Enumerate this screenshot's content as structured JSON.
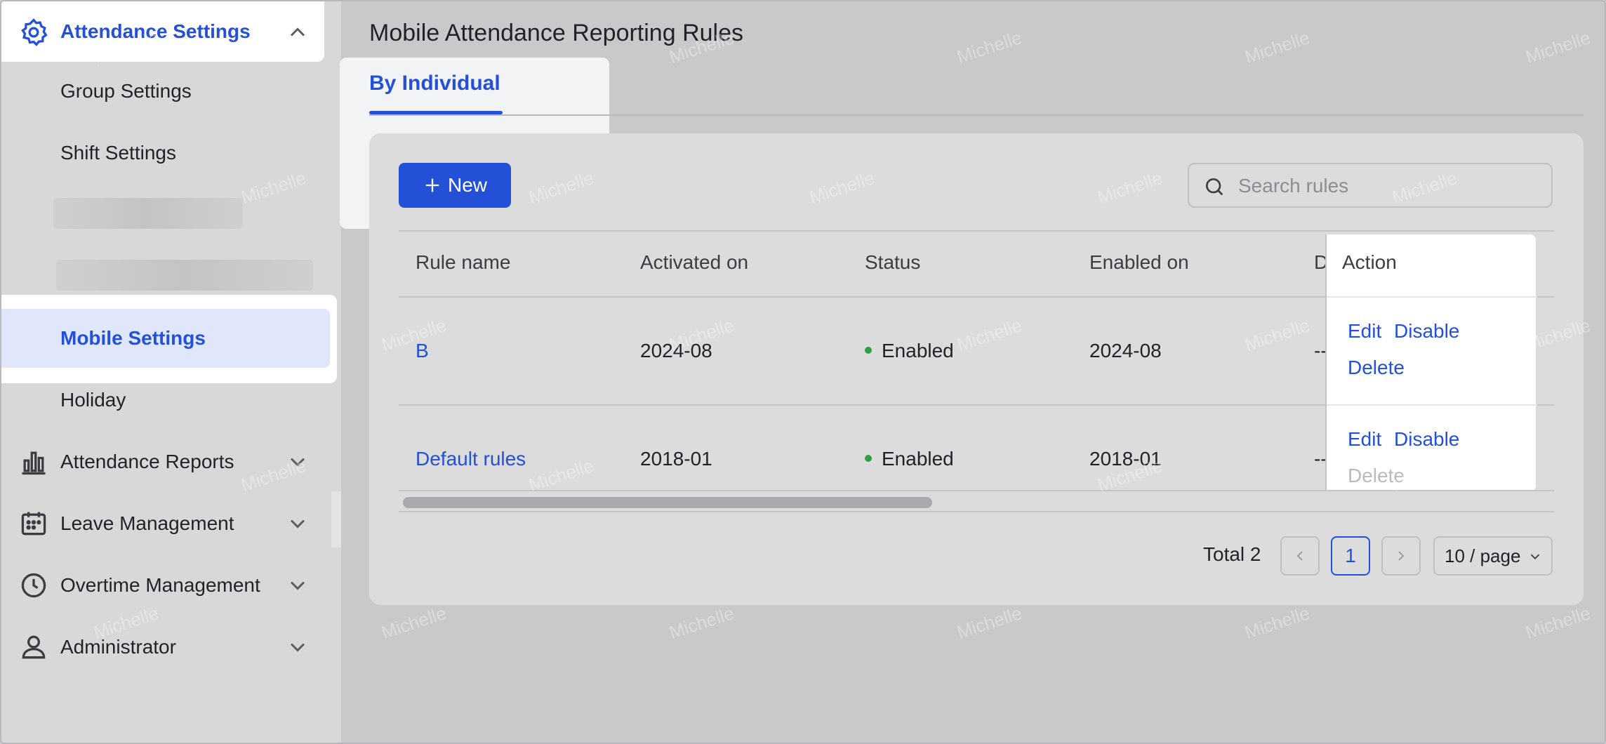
{
  "sidebar": {
    "top": {
      "label": "Attendance Settings"
    },
    "items": [
      {
        "label": "Group Settings"
      },
      {
        "label": "Shift Settings"
      },
      {
        "label": "Mobile Settings"
      },
      {
        "label": "Holiday"
      }
    ],
    "sections": [
      {
        "label": "Attendance Reports"
      },
      {
        "label": "Leave Management"
      },
      {
        "label": "Overtime Management"
      },
      {
        "label": "Administrator"
      }
    ]
  },
  "main": {
    "title": "Mobile Attendance Reporting Rules",
    "tab": "By Individual",
    "new_button": "New",
    "search_placeholder": "Search rules",
    "columns": [
      "Rule name",
      "Activated on",
      "Status",
      "Enabled on",
      "D",
      "Action"
    ],
    "rows": [
      {
        "name": "B",
        "activated": "2024-08",
        "status": "Enabled",
        "enabled": "2024-08",
        "d": "--",
        "actions": [
          "Edit",
          "Disable",
          "Delete"
        ]
      },
      {
        "name": "Default rules",
        "activated": "2018-01",
        "status": "Enabled",
        "enabled": "2018-01",
        "d": "--",
        "actions": [
          "Edit",
          "Disable",
          "Delete"
        ]
      }
    ],
    "pagination": {
      "total": "Total 2",
      "current": "1",
      "page_size": "10 / page"
    }
  },
  "watermark": "Michelle",
  "colors": {
    "accent": "#2450d8",
    "status_enabled": "#2f9e44",
    "highlight": "#e1e7fb"
  }
}
